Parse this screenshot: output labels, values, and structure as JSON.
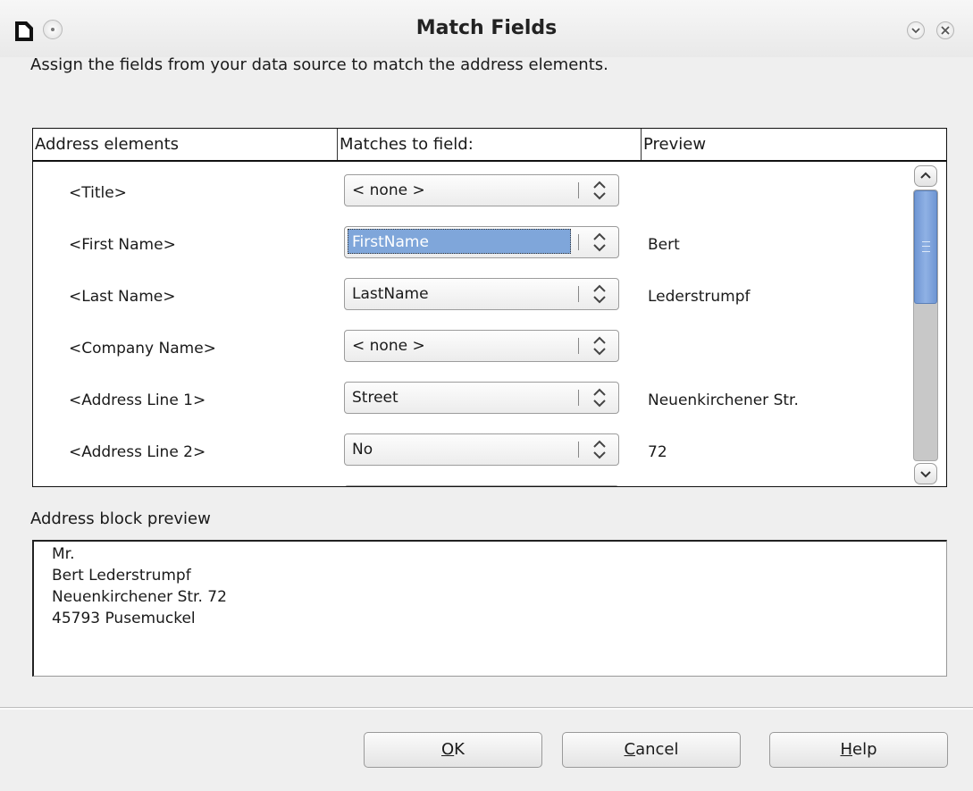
{
  "window": {
    "title": "Match Fields"
  },
  "instructions": "Assign the fields from your data source to match the address elements.",
  "table": {
    "headers": [
      "Address elements",
      "Matches to field:",
      "Preview"
    ],
    "rows": [
      {
        "element": "<Title>",
        "field": "< none >",
        "preview": "",
        "selected": false
      },
      {
        "element": "<First Name>",
        "field": "FirstName",
        "preview": "Bert",
        "selected": true
      },
      {
        "element": "<Last Name>",
        "field": "LastName",
        "preview": "Lederstrumpf",
        "selected": false
      },
      {
        "element": "<Company Name>",
        "field": "< none >",
        "preview": "",
        "selected": false
      },
      {
        "element": "<Address Line 1>",
        "field": "Street",
        "preview": "Neuenkirchener Str.",
        "selected": false
      },
      {
        "element": "<Address Line 2>",
        "field": "No",
        "preview": "72",
        "selected": false
      }
    ]
  },
  "address_preview": {
    "label": "Address block preview",
    "lines": [
      "Mr.",
      "Bert Lederstrumpf",
      "Neuenkirchener Str. 72",
      "45793 Pusemuckel"
    ]
  },
  "buttons": {
    "ok": {
      "mnemonic": "O",
      "rest": "K"
    },
    "cancel": {
      "mnemonic": "C",
      "rest": "ancel"
    },
    "help": {
      "mnemonic": "H",
      "rest": "elp"
    }
  },
  "colors": {
    "selection": "#7fa6da",
    "scroll_thumb": "#7fa6da"
  }
}
